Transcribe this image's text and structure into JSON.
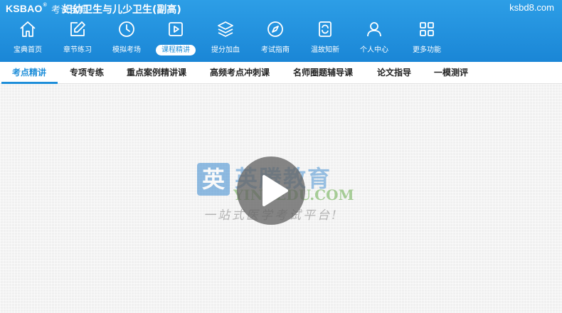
{
  "header": {
    "logo": "KSBAO",
    "logo_reg": "®",
    "slogan": "考试宝典",
    "title": "妇幼卫生与儿少卫生(副高)",
    "site_url": "ksbd8.com"
  },
  "nav": {
    "items": [
      {
        "label": "宝典首页",
        "icon": "home-icon"
      },
      {
        "label": "章节练习",
        "icon": "edit-icon"
      },
      {
        "label": "模拟考场",
        "icon": "clock-icon"
      },
      {
        "label": "课程精讲",
        "icon": "play-square-icon",
        "active": true
      },
      {
        "label": "提分加血",
        "icon": "layers-icon"
      },
      {
        "label": "考试指南",
        "icon": "compass-icon"
      },
      {
        "label": "温故知新",
        "icon": "refresh-doc-icon"
      },
      {
        "label": "个人中心",
        "icon": "user-icon"
      },
      {
        "label": "更多功能",
        "icon": "grid-icon"
      }
    ]
  },
  "subtabs": [
    {
      "label": "考点精讲",
      "active": true
    },
    {
      "label": "专项专练"
    },
    {
      "label": "重点案例精讲课"
    },
    {
      "label": "高频考点冲刺课"
    },
    {
      "label": "名师圈题辅导课"
    },
    {
      "label": "论文指导"
    },
    {
      "label": "一模测评"
    }
  ],
  "watermark": {
    "box_char": "英",
    "cn": "英腾教育",
    "en": "YINGEDU.COM",
    "slogan": "一站式医学考试平台!"
  },
  "colors": {
    "header": "#1a86d6",
    "accent": "#1e8ed9"
  }
}
